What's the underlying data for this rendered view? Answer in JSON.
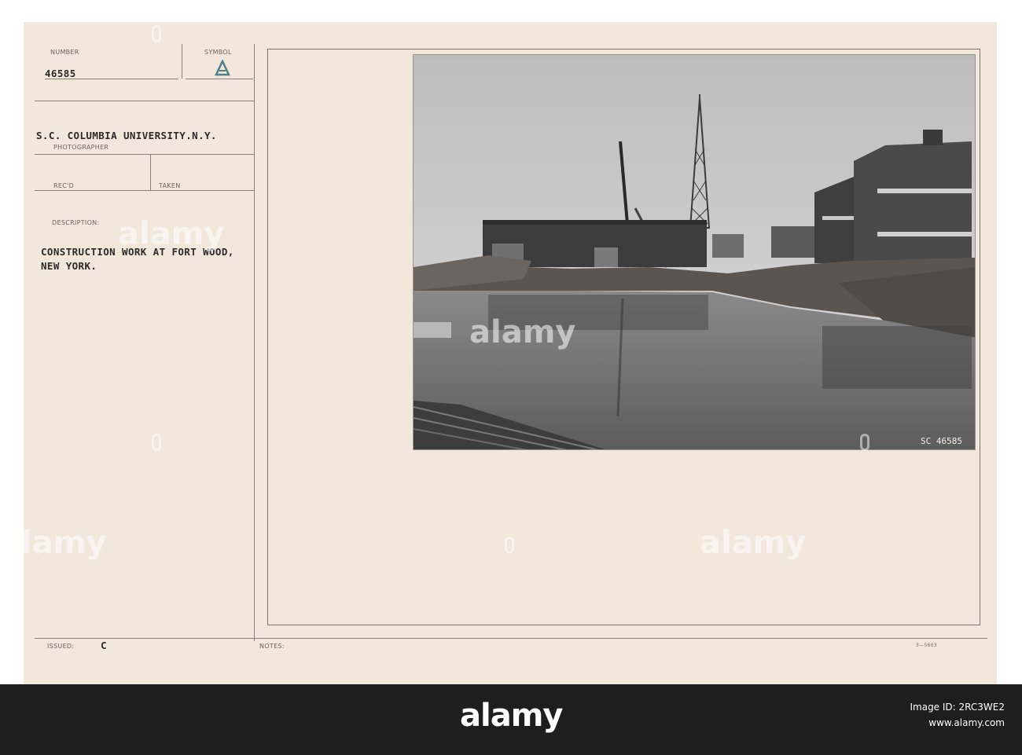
{
  "card": {
    "number_label": "NUMBER",
    "number_value": "46585",
    "symbol_label": "SYMBOL",
    "photographer_value": "S.C. COLUMBIA UNIVERSITY.N.Y.",
    "photographer_label": "PHOTOGRAPHER",
    "recd_label": "REC'D",
    "taken_label": "TAKEN",
    "description_label": "DESCRIPTION:",
    "description_line1": "CONSTRUCTION WORK AT FORT WOOD,",
    "description_line2": "NEW YORK.",
    "issued_label": "ISSUED:",
    "issued_value": "C",
    "notes_label": "NOTES:",
    "form_number": "3—5603"
  },
  "photo": {
    "negative_number": "SC 46585"
  },
  "watermark": {
    "text": "alamy"
  },
  "footer": {
    "brand": "alamy",
    "image_id_line": "Image ID: 2RC3WE2",
    "site": "www.alamy.com"
  },
  "colors": {
    "card_background": "#f1e7db",
    "band": "#1e1e1e",
    "sky": "#cfcfcf",
    "water": "#6f6f6f"
  }
}
